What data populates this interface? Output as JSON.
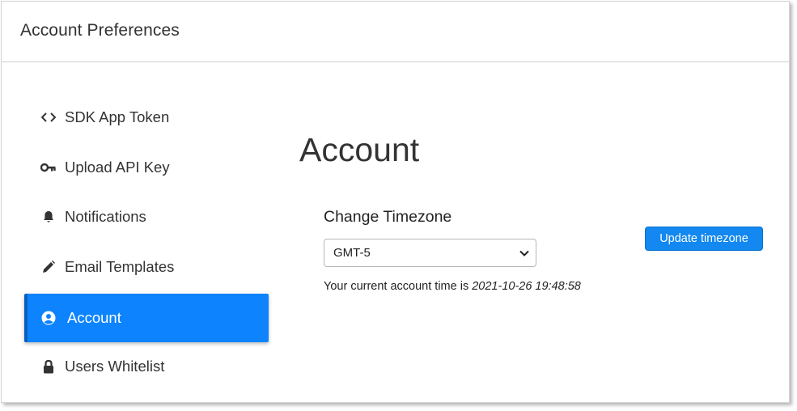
{
  "header": {
    "title": "Account Preferences"
  },
  "sidebar": {
    "items": [
      {
        "label": "SDK App Token",
        "icon": "code-icon"
      },
      {
        "label": "Upload API Key",
        "icon": "key-icon"
      },
      {
        "label": "Notifications",
        "icon": "bell-icon"
      },
      {
        "label": "Email Templates",
        "icon": "pencil-icon"
      },
      {
        "label": "Account",
        "icon": "user-circle-icon",
        "active": true
      },
      {
        "label": "Users Whitelist",
        "icon": "lock-icon"
      }
    ]
  },
  "main": {
    "title": "Account",
    "timezone": {
      "label": "Change Timezone",
      "selected": "GMT-5",
      "current_time_prefix": "Your current account time is",
      "current_time_value": "2021-10-26 19:48:58",
      "update_button": "Update timezone"
    }
  },
  "colors": {
    "accent": "#0d84fd",
    "accent_border": "#0a5fc2",
    "button": "#1288f0"
  }
}
